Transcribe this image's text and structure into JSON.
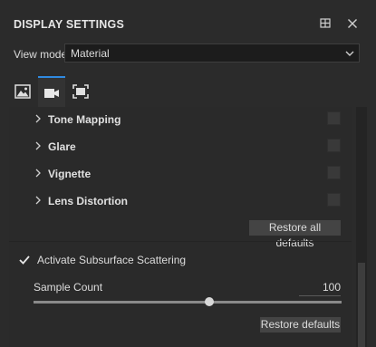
{
  "header": {
    "title": "DISPLAY SETTINGS"
  },
  "view_mode": {
    "label": "View mode",
    "value": "Material"
  },
  "tabs": [
    {
      "icon": "image-icon"
    },
    {
      "icon": "camera-icon",
      "active": true
    },
    {
      "icon": "frame-icon"
    }
  ],
  "sections": [
    {
      "label": "Tone Mapping"
    },
    {
      "label": "Glare"
    },
    {
      "label": "Vignette"
    },
    {
      "label": "Lens Distortion"
    }
  ],
  "restore_all_label": "Restore all defaults",
  "subsurface": {
    "label": "Activate Subsurface Scattering",
    "checked": true
  },
  "sample_count": {
    "label": "Sample Count",
    "value": "100",
    "slider_fraction": 0.57
  },
  "restore_label": "Restore defaults",
  "colors": {
    "accent": "#2f8ae0",
    "background": "#2b2b2b"
  }
}
